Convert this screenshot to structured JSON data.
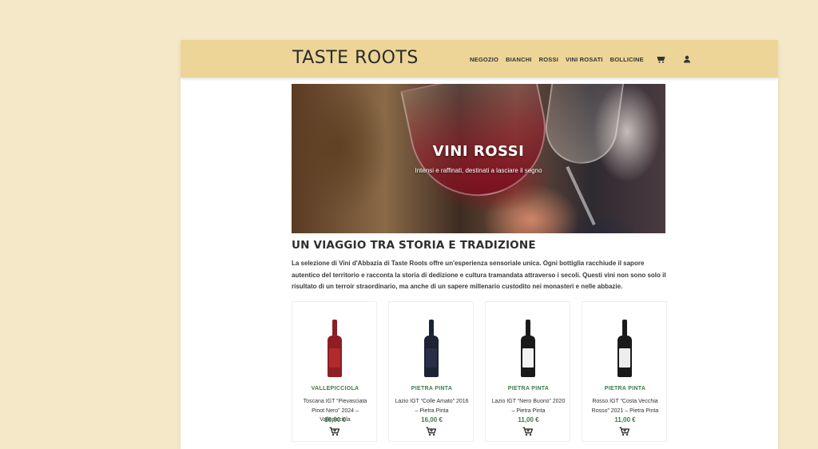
{
  "header": {
    "logo": "TASTE ROOTS",
    "nav": [
      "NEGOZIO",
      "BIANCHI",
      "ROSSI",
      "VINI ROSATI",
      "BOLLICINE"
    ],
    "icons": [
      "cart-icon",
      "user-icon"
    ]
  },
  "hero": {
    "title": "VINI ROSSI",
    "subtitle": "Intensi e raffinati, destinati a lasciare il segno"
  },
  "section": {
    "title": "UN VIAGGIO TRA STORIA E TRADIZIONE",
    "text": "La selezione di Vini d'Abbazia di Taste Roots offre un'esperienza sensoriale unica. Ogni bottiglia racchiude il sapore autentico del territorio e racconta la storia di dedizione e cultura tramandata attraverso i secoli. Questi vini non sono solo il risultato di un terroir straordinario, ma anche di un sapere millenario custodito nei monasteri e nelle abbazie."
  },
  "products": [
    {
      "producer": "VALLEPICCIOLA",
      "name": "Toscana IGT “Pievasciata Pinot Nero” 2024 – Vallepicciola",
      "price": "16,00 €",
      "bottle_color": "#8e1e23",
      "label_color": "#b02a2e"
    },
    {
      "producer": "PIETRA PINTA",
      "name": "Lazio IGT “Colle Amato” 2016 – Pietra Pinta",
      "price": "16,00 €",
      "bottle_color": "#1d2235",
      "label_color": "#2a2f48"
    },
    {
      "producer": "PIETRA PINTA",
      "name": "Lazio IGT “Nero Buono” 2020 – Pietra Pinta",
      "price": "11,00 €",
      "bottle_color": "#1a1a1a",
      "label_color": "#f2f2f2"
    },
    {
      "producer": "PIETRA PINTA",
      "name": "Rosso IGT “Costa Vecchia Rosso” 2021 – Pietra Pinta",
      "price": "11,00 €",
      "bottle_color": "#1a1a1a",
      "label_color": "#ededed"
    }
  ],
  "colors": {
    "page_bg": "#f5e8c8",
    "header_bg": "#ecd597",
    "accent_green": "#3c7a4a"
  }
}
